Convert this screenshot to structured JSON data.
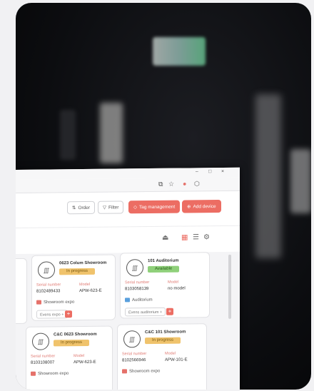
{
  "window": {
    "minimize": "–",
    "maximize": "□",
    "close": "×"
  },
  "browser": {
    "icons": [
      "cast-icon",
      "star-icon",
      "profile-icon",
      "extensions-icon"
    ]
  },
  "toolbar": {
    "order_label": "Order",
    "filter_label": "Filter",
    "tag_label": "Tag management",
    "add_label": "Add device"
  },
  "labels": {
    "serial": "Serial number",
    "model": "Model"
  },
  "cards": [
    {
      "title": "0623 Colum Showroom",
      "status": "In progress",
      "status_type": "progress",
      "serial": "8102489433",
      "model": "APW-623-E",
      "location": "Showroom expo",
      "event": "Evens expo",
      "event_suffix": "+"
    },
    {
      "title": "101 Auditorium",
      "status": "Available",
      "status_type": "available",
      "serial": "8103058139",
      "model": "no model",
      "location": "Auditorium",
      "event": "Evens auditorium",
      "event_suffix": "+"
    },
    {
      "title": "C&C 0623 Showroom",
      "status": "In progress",
      "status_type": "progress",
      "serial": "8103108007",
      "model": "APW-623-E",
      "location": "Showroom expo"
    },
    {
      "title": "C&C 101 Showroom",
      "status": "In progress",
      "status_type": "progress",
      "serial": "8102566946",
      "model": "APW-101-E",
      "location": "Showroom expo"
    }
  ],
  "colors": {
    "accent": "#ec6d63",
    "progress": "#f0c36c",
    "available": "#8fd07a",
    "background": "#0c0d10"
  }
}
